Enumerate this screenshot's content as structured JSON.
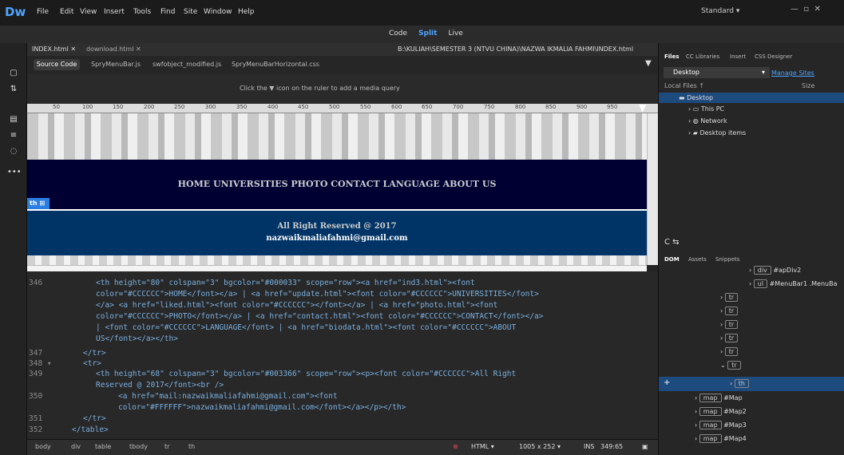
{
  "app": {
    "logo": "Dw",
    "menus": [
      "File",
      "Edit",
      "View",
      "Insert",
      "Tools",
      "Find",
      "Site",
      "Window",
      "Help"
    ],
    "workspace": "Standard"
  },
  "views": [
    "Code",
    "Split",
    "Live"
  ],
  "tabs": [
    "INDEX.html",
    "download.html"
  ],
  "doc_path": "B:\\KULIAH\\SEMESTER 3 (NTVU CHINA)\\NAZWA IKMALIA FAHMI\\INDEX.html",
  "related_files": [
    "Source Code",
    "SpryMenuBar.js",
    "swfobject_modified.js",
    "SpryMenuBarHorizontal.css"
  ],
  "media_query_hint": "Click the ▼ icon on the ruler to add a media query",
  "ruler": [
    "50",
    "100",
    "150",
    "200",
    "250",
    "300",
    "350",
    "400",
    "450",
    "500",
    "550",
    "600",
    "650",
    "700",
    "750",
    "800",
    "850",
    "900",
    "950"
  ],
  "design": {
    "nav": "HOME  UNIVERSITIES  PHOTO  CONTACT  LANGUAGE  ABOUT US",
    "badge": "th",
    "footer1": "All Right Reserved @ 2017",
    "footer2": "nazwaikmaliafahmi@gmail.com"
  },
  "line_numbers": [
    "346",
    "",
    "",
    "",
    "",
    "",
    "347",
    "348 ▾",
    "349",
    "",
    "350",
    "",
    "351",
    "352"
  ],
  "code_lines": [
    "<th height=\"80\" colspan=\"3\" bgcolor=\"#000033\" scope=\"row\"><a href=\"ind3.html\"><font",
    "color=\"#CCCCCC\">HOME</font></a> | <a href=\"update.html\"><font color=\"#CCCCCC\">UNIVERSITIES</font>",
    "</a> <a href=\"liked.html\"><font color=\"#CCCCCC\"></font></a> | <a href=\"photo.html\"><font",
    "color=\"#CCCCCC\">PHOTO</font></a> | <a href=\"contact.html\"><font color=\"#CCCCCC\">CONTACT</font></a>",
    "| <font color=\"#CCCCCC\">LANGUAGE</font> | <a href=\"biodata.html\"><font color=\"#CCCCCC\">ABOUT",
    "US</font></a></th>",
    "</tr>",
    "<tr>",
    "<th height=\"68\" colspan=\"3\" bgcolor=\"#003366\" scope=\"row\"><p><font color=\"#CCCCCC\">All Right",
    "Reserved @ 2017</font><br />",
    "<a href=\"mail:nazwaikmaliafahmi@gmail.com\"><font",
    "color=\"#FFFFFF\">nazwaikmaliafahmi@gmail.com</font></a></p></th>",
    "</tr>",
    "</table>"
  ],
  "breadcrumbs": [
    "body",
    "div",
    "table",
    "tbody",
    "tr",
    "th"
  ],
  "status": {
    "mode": "HTML",
    "size": "1005 x 252",
    "ins": "INS",
    "pos": "349:65"
  },
  "files": {
    "tabs": [
      "Files",
      "CC Libraries",
      "Insert",
      "CSS Designer"
    ],
    "location": "Desktop",
    "manage": "Manage Sites",
    "col1": "Local Files ↑",
    "col2": "Size",
    "items": [
      "Desktop",
      "This PC",
      "Network",
      "Desktop items"
    ]
  },
  "dom": {
    "tabs": [
      "DOM",
      "Assets",
      "Snippets"
    ],
    "rows": [
      {
        "tag": "div",
        "label": "#apDiv2"
      },
      {
        "tag": "ul",
        "label": "#MenuBar1 .MenuBa"
      },
      {
        "tag": "tr",
        "label": ""
      },
      {
        "tag": "tr",
        "label": ""
      },
      {
        "tag": "tr",
        "label": ""
      },
      {
        "tag": "tr",
        "label": ""
      },
      {
        "tag": "tr",
        "label": ""
      },
      {
        "tag": "tr",
        "label": ""
      },
      {
        "tag": "th",
        "label": ""
      },
      {
        "tag": "map",
        "label": "#Map"
      },
      {
        "tag": "map",
        "label": "#Map2"
      },
      {
        "tag": "map",
        "label": "#Map3"
      },
      {
        "tag": "map",
        "label": "#Map4"
      }
    ]
  }
}
